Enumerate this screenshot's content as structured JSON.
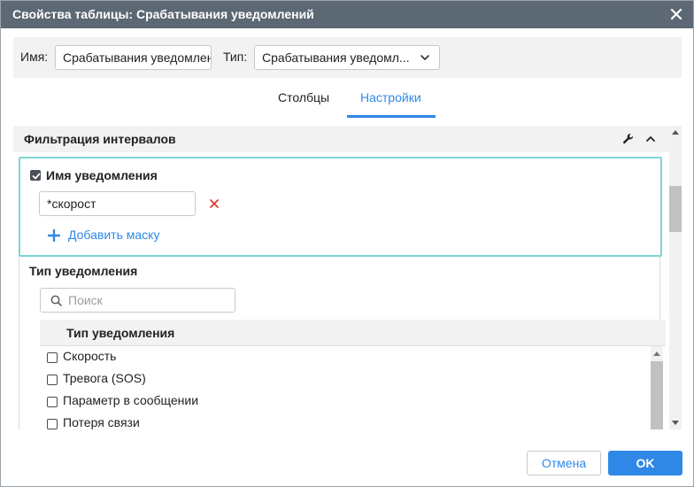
{
  "dialog": {
    "title": "Свойства таблицы: Срабатывания уведомлений"
  },
  "form": {
    "name_label": "Имя:",
    "name_value": "Срабатывания уведомлени",
    "type_label": "Тип:",
    "type_value": "Срабатывания уведомл..."
  },
  "tabs": [
    {
      "label": "Столбцы",
      "active": false
    },
    {
      "label": "Настройки",
      "active": true
    }
  ],
  "interval_filter": {
    "title": "Фильтрация интервалов",
    "notification_name": {
      "label": "Имя уведомления",
      "checked": true,
      "mask_value": "*скорост",
      "add_mask_label": "Добавить маску"
    },
    "notification_type": {
      "label": "Тип уведомления",
      "search_placeholder": "Поиск",
      "column_header": "Тип уведомления",
      "items": [
        {
          "label": "Скорость",
          "checked": false
        },
        {
          "label": "Тревога (SOS)",
          "checked": false
        },
        {
          "label": "Параметр в сообщении",
          "checked": false
        },
        {
          "label": "Потеря связи",
          "checked": false
        }
      ]
    }
  },
  "footer": {
    "cancel_label": "Отмена",
    "ok_label": "OK"
  },
  "colors": {
    "titlebar": "#5c6874",
    "accent": "#2f88e6",
    "highlight_border": "#7dd5d4",
    "delete": "#e03c31"
  },
  "icons": [
    "close-icon",
    "chevron-down-icon",
    "wrench-icon",
    "chevron-up-icon",
    "checkbox-checked-icon",
    "delete-x-icon",
    "plus-icon",
    "search-icon"
  ]
}
